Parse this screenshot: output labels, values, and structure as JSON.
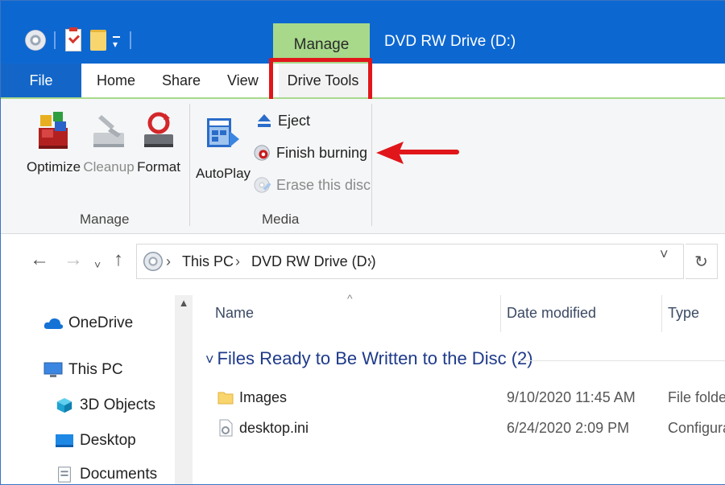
{
  "window": {
    "title": "DVD RW Drive (D:)",
    "context_tab_group": "Manage"
  },
  "tabs": [
    "File",
    "Home",
    "Share",
    "View",
    "Drive Tools"
  ],
  "ribbon": {
    "manage_group": {
      "label": "Manage",
      "buttons": [
        {
          "label": "Optimize",
          "icon": "optimize-icon",
          "enabled": true
        },
        {
          "label": "Cleanup",
          "icon": "cleanup-icon",
          "enabled": false
        },
        {
          "label": "Format",
          "icon": "format-icon",
          "enabled": true
        }
      ]
    },
    "media_group": {
      "label": "Media",
      "autoplay": "AutoPlay",
      "eject": "Eject",
      "finish_burning": "Finish burning",
      "erase": "Erase this disc"
    }
  },
  "address": {
    "crumbs": [
      "This PC",
      "DVD RW Drive (D:)"
    ]
  },
  "sidebar": {
    "items": [
      "OneDrive",
      "This PC",
      "3D Objects",
      "Desktop",
      "Documents"
    ]
  },
  "columns": [
    "Name",
    "Date modified",
    "Type"
  ],
  "group": {
    "title": "Files Ready to Be Written to the Disc (2)"
  },
  "files": [
    {
      "name": "Images",
      "date": "9/10/2020 11:45 AM",
      "type": "File folder",
      "icon": "folder-icon"
    },
    {
      "name": "desktop.ini",
      "date": "6/24/2020 2:09 PM",
      "type": "Configura",
      "icon": "settings-file-icon"
    }
  ],
  "colors": {
    "titlebar": "#0d67d1",
    "context_tab": "#a8d98a",
    "highlight": "#e0161a"
  }
}
